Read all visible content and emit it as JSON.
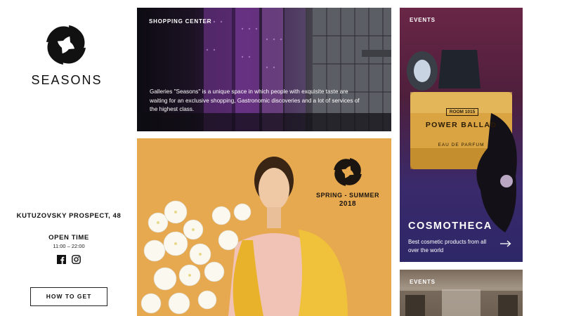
{
  "brand": {
    "name": "SEASONS"
  },
  "sidebar": {
    "address": "KUTUZOVSKY PROSPECT, 48",
    "open_time_title": "OPEN TIME",
    "open_time_hours": "11:00 – 22:00",
    "socials": [
      "facebook-icon",
      "instagram-icon"
    ],
    "how_to_get": "HOW TO GET"
  },
  "tiles": {
    "shopping_center": {
      "label": "SHOPPING CENTER",
      "description": "Galleries \"Seasons\" is a unique space in which people with exquisite taste are waiting for an exclusive shopping, Gastronomic discoveries and a lot of services of the highest class."
    },
    "spring_summer": {
      "title": "SPRING - SUMMER",
      "year": "2018"
    },
    "events_cosmotheca": {
      "label": "EVENTS",
      "bottle_brand": "ROOM 1015",
      "bottle_name": "POWER BALLAD",
      "bottle_sub": "EAU DE PARFUM",
      "title": "COSMOTHECA",
      "description": "Best cosmetic products from all over the world"
    },
    "events_second": {
      "label": "EVENTS"
    }
  },
  "colors": {
    "accent_text": "#111111",
    "white": "#ffffff",
    "spring_bg": "#e7a94f",
    "cosmo_bg": "#4e1f3c"
  }
}
